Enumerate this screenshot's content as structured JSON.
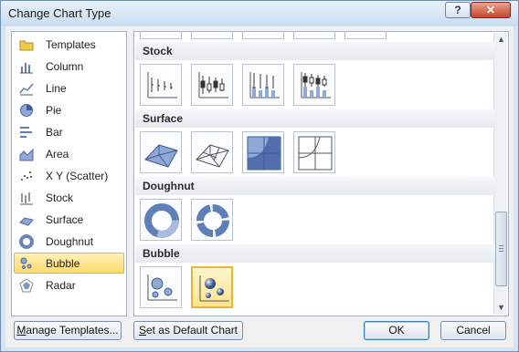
{
  "window": {
    "title": "Change Chart Type",
    "help_label": "?",
    "close_label": "✕"
  },
  "chart_types": [
    {
      "label": "Templates",
      "icon": "folder-icon",
      "selected": false
    },
    {
      "label": "Column",
      "icon": "column-chart-icon",
      "selected": false
    },
    {
      "label": "Line",
      "icon": "line-chart-icon",
      "selected": false
    },
    {
      "label": "Pie",
      "icon": "pie-chart-icon",
      "selected": false
    },
    {
      "label": "Bar",
      "icon": "bar-chart-icon",
      "selected": false
    },
    {
      "label": "Area",
      "icon": "area-chart-icon",
      "selected": false
    },
    {
      "label": "X Y (Scatter)",
      "icon": "scatter-chart-icon",
      "selected": false
    },
    {
      "label": "Stock",
      "icon": "stock-chart-icon",
      "selected": false
    },
    {
      "label": "Surface",
      "icon": "surface-chart-icon",
      "selected": false
    },
    {
      "label": "Doughnut",
      "icon": "doughnut-chart-icon",
      "selected": false
    },
    {
      "label": "Bubble",
      "icon": "bubble-chart-icon",
      "selected": true
    },
    {
      "label": "Radar",
      "icon": "radar-chart-icon",
      "selected": false
    }
  ],
  "gallery": {
    "sections": [
      {
        "name": "Stock",
        "subtypes": [
          "stock-high-low-close-icon",
          "stock-open-high-low-close-icon",
          "stock-volume-high-low-close-icon",
          "stock-volume-open-high-low-close-icon"
        ]
      },
      {
        "name": "Surface",
        "subtypes": [
          "surface-3d-icon",
          "surface-wireframe-3d-icon",
          "surface-contour-icon",
          "surface-wireframe-contour-icon"
        ]
      },
      {
        "name": "Doughnut",
        "subtypes": [
          "doughnut-icon",
          "exploded-doughnut-icon"
        ]
      },
      {
        "name": "Bubble",
        "subtypes": [
          "bubble-icon",
          "bubble-3d-effect-icon"
        ]
      }
    ],
    "selected_subtype": "bubble-3d-effect-icon"
  },
  "buttons": {
    "manage_templates": {
      "u": "M",
      "rest": "anage Templates..."
    },
    "set_default": {
      "u": "S",
      "rest": "et as Default Chart"
    },
    "ok": "OK",
    "cancel": "Cancel"
  },
  "colors": {
    "selection_fill": "#fcd96a",
    "selection_border": "#e1b23c",
    "chart_blue": "#5f7fb8"
  }
}
